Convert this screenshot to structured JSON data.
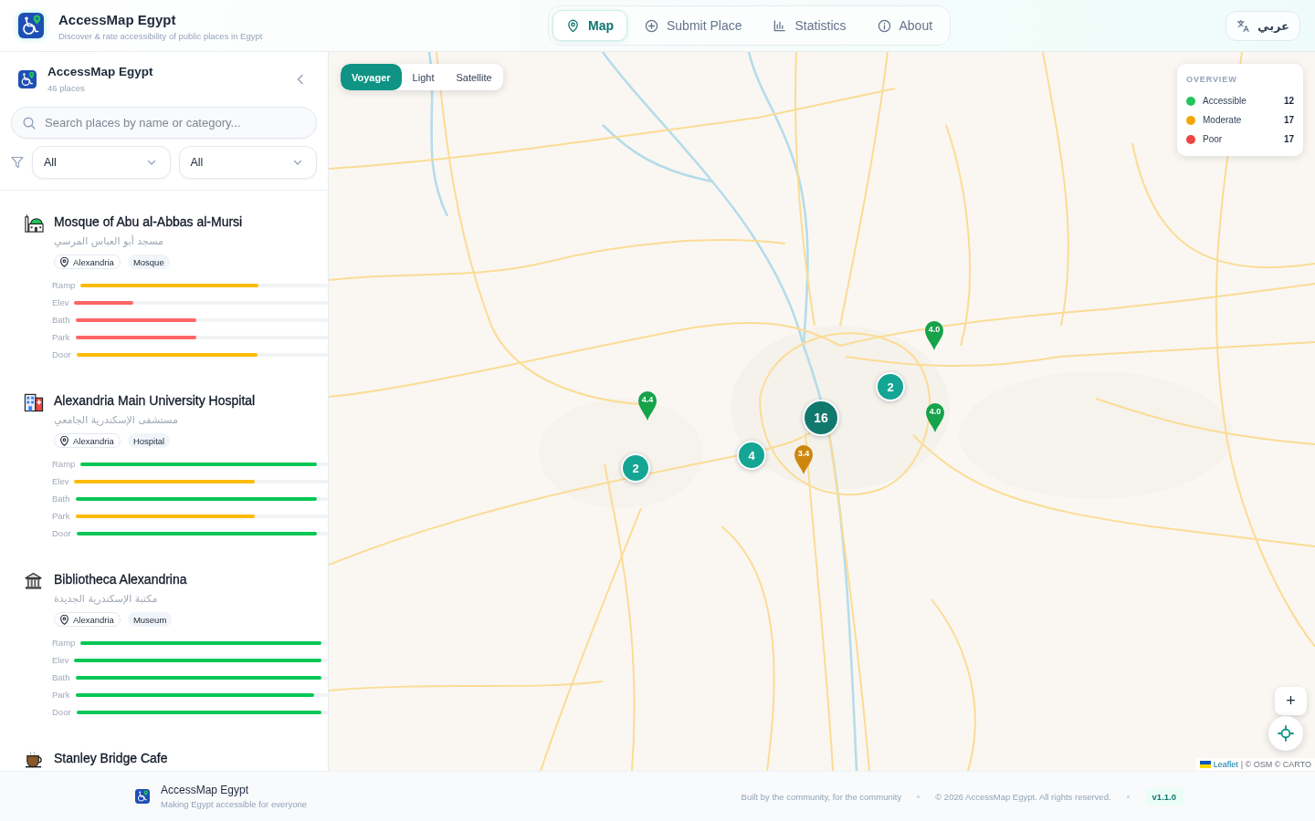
{
  "header": {
    "title": "AccessMap Egypt",
    "subtitle": "Discover & rate accessibility of public places in Egypt",
    "tabs": [
      {
        "label": "Map",
        "selected": true
      },
      {
        "label": "Submit Place",
        "selected": false
      },
      {
        "label": "Statistics",
        "selected": false
      },
      {
        "label": "About",
        "selected": false
      }
    ],
    "language_button": "عربي"
  },
  "sidebar": {
    "title": "AccessMap Egypt",
    "count": "46 places",
    "search": {
      "placeholder": "Search places by name or category..."
    },
    "filters": [
      {
        "value": "All"
      },
      {
        "value": "All"
      }
    ],
    "places": [
      {
        "name": "Mosque of Abu al-Abbas al-Mursi",
        "name_ar": "مسجد أبو العباس المرسي",
        "city": "Alexandria",
        "category": "Mosque",
        "ratings": [
          {
            "label": "Ramp",
            "level": 0.74
          },
          {
            "label": "Elev",
            "level": 0.24
          },
          {
            "label": "Bath",
            "level": 0.49
          },
          {
            "label": "Park",
            "level": 0.49
          },
          {
            "label": "Door",
            "level": 0.74
          }
        ]
      },
      {
        "name": "Alexandria Main University Hospital",
        "name_ar": "مستشفى الإسكندرية الجامعي",
        "city": "Alexandria",
        "category": "Hospital",
        "ratings": [
          {
            "label": "Ramp",
            "level": 0.98
          },
          {
            "label": "Elev",
            "level": 0.73
          },
          {
            "label": "Bath",
            "level": 0.98
          },
          {
            "label": "Park",
            "level": 0.73
          },
          {
            "label": "Door",
            "level": 0.98
          }
        ]
      },
      {
        "name": "Bibliotheca Alexandrina",
        "name_ar": "مكتبة الإسكندرية الجديدة",
        "city": "Alexandria",
        "category": "Museum",
        "ratings": [
          {
            "label": "Ramp",
            "level": 1
          },
          {
            "label": "Elev",
            "level": 1
          },
          {
            "label": "Bath",
            "level": 1
          },
          {
            "label": "Park",
            "level": 0.97
          },
          {
            "label": "Door",
            "level": 1
          }
        ]
      },
      {
        "name": "Stanley Bridge Cafe"
      }
    ]
  },
  "map": {
    "layers": [
      {
        "label": "Voyager",
        "selected": true
      },
      {
        "label": "Light",
        "selected": false
      },
      {
        "label": "Satellite",
        "selected": false
      }
    ],
    "overview": {
      "title": "OVERVIEW",
      "rows": [
        {
          "label": "Accessible",
          "count": "12",
          "color": "#22c55e"
        },
        {
          "label": "Moderate",
          "count": "17",
          "color": "#f5a50b"
        },
        {
          "label": "Poor",
          "count": "17",
          "color": "#ef4444"
        }
      ]
    },
    "clusters": [
      {
        "count": "16"
      },
      {
        "count": "2"
      },
      {
        "count": "4"
      },
      {
        "count": "2"
      }
    ],
    "pins": [
      {
        "rating": "4.4",
        "color": "#16a34a"
      },
      {
        "rating": "4.0",
        "color": "#16a34a"
      },
      {
        "rating": "4.0",
        "color": "#16a34a"
      },
      {
        "rating": "3.4",
        "color": "#cd870f"
      }
    ],
    "zoom_in": "+",
    "attribution": {
      "link": "Leaflet",
      "text": "| © OSM © CARTO"
    }
  },
  "footer": {
    "brand": "AccessMap Egypt",
    "tagline": "Making Egypt accessible for everyone",
    "meta": [
      "Built by the community, for the community",
      "© 2026 AccessMap Egypt. All rights reserved."
    ],
    "version": "v1.1.0"
  }
}
